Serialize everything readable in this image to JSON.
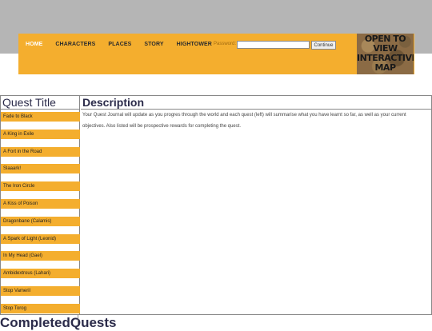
{
  "nav": {
    "items": [
      {
        "label": "HOME",
        "active": true
      },
      {
        "label": "CHARACTERS",
        "active": false
      },
      {
        "label": "PLACES",
        "active": false
      },
      {
        "label": "STORY",
        "active": false
      },
      {
        "label": "HIGHTOWER",
        "active": false
      }
    ],
    "password_label": "Password:",
    "password_value": "",
    "continue_label": "Continue"
  },
  "map_button": {
    "line1": "OPEN TO VIEW",
    "line2": "INTERACTIVE",
    "line3": "MAP"
  },
  "journal": {
    "quest_title_header": "Quest Title",
    "description_header": "Description",
    "description_text": "Your Quest Journal will update as you progres through the world and each quest (left) will summarise what you have learnt so far, as well as your current objectives. Also listed will be prospective rewards for completing the quest.",
    "quests": [
      "Fade to Black",
      "A King in Exile",
      "A Fort in the Road",
      "Slaaark!",
      "The Iron Circle",
      "A Kiss of Poison",
      "Dragonbane (Calamis)",
      "A Spark of Light (Leonid)",
      "In My Head (Gael)",
      "Ambidextrous (Lahari)",
      "Stop Vameril",
      "Stop Torog"
    ]
  },
  "completed": {
    "left": "Completed",
    "right": "Quests"
  },
  "colors": {
    "accent": "#f4ae2e",
    "topband": "#b5b5b5",
    "header_text": "#2b2b4a"
  }
}
